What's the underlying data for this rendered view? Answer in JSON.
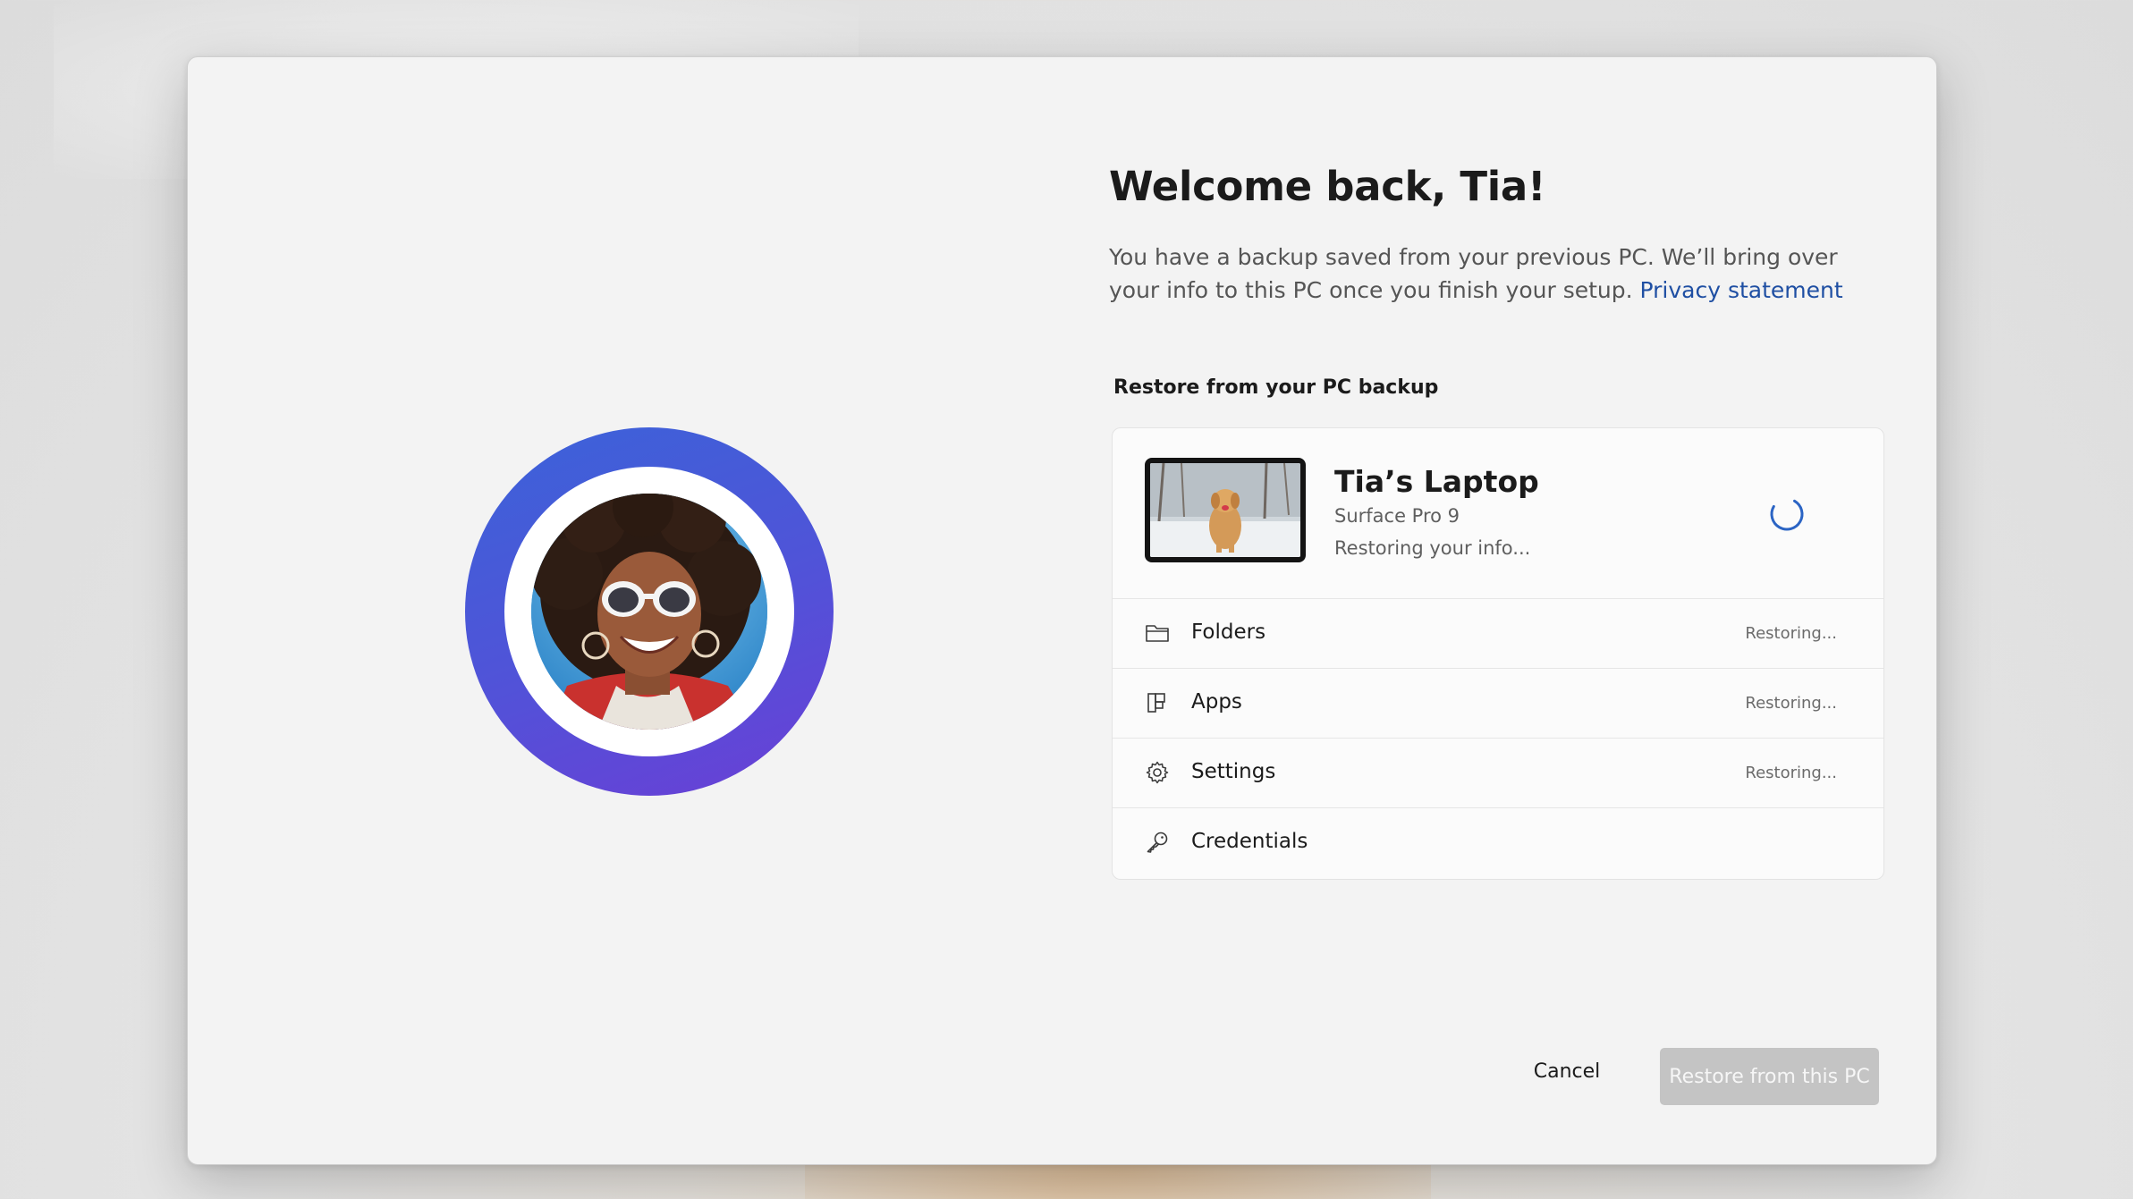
{
  "dialog": {
    "title": "Welcome back, Tia!",
    "description": "You have a backup saved from your previous PC. We’ll bring over your info to this PC once you finish your setup.",
    "privacy_link": "Privacy statement",
    "section_label": "Restore from your PC backup"
  },
  "device": {
    "name": "Tia’s Laptop",
    "model": "Surface Pro 9",
    "status": "Restoring your info..."
  },
  "items": [
    {
      "label": "Folders",
      "status": "Restoring...",
      "icon": "folder-icon"
    },
    {
      "label": "Apps",
      "status": "Restoring...",
      "icon": "apps-icon"
    },
    {
      "label": "Settings",
      "status": "Restoring...",
      "icon": "gear-icon"
    },
    {
      "label": "Credentials",
      "status": "",
      "icon": "key-icon"
    }
  ],
  "buttons": {
    "cancel": "Cancel",
    "restore": "Restore from this PC"
  },
  "colors": {
    "accent_ring_start": "#3b63d9",
    "accent_ring_end": "#6a3fd6",
    "link": "#1f4fa3",
    "spinner": "#2b64c4",
    "disabled_button": "#c4c4c4"
  }
}
